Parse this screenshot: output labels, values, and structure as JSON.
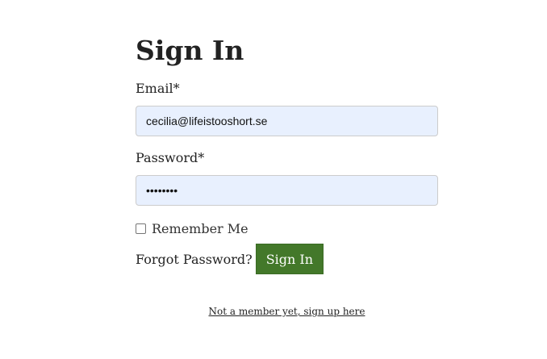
{
  "form": {
    "title": "Sign In",
    "email": {
      "label": "Email*",
      "value": "cecilia@lifeistooshort.se"
    },
    "password": {
      "label": "Password*",
      "masked_value": "••••••••"
    },
    "remember": {
      "label": "Remember Me",
      "checked": false
    },
    "forgot_label": "Forgot Password?",
    "submit_label": "Sign In",
    "signup_label": "Not a member yet, sign up here"
  },
  "colors": {
    "button_bg": "#43782a",
    "input_autofill_bg": "#e8f0fe",
    "text": "#222222"
  }
}
